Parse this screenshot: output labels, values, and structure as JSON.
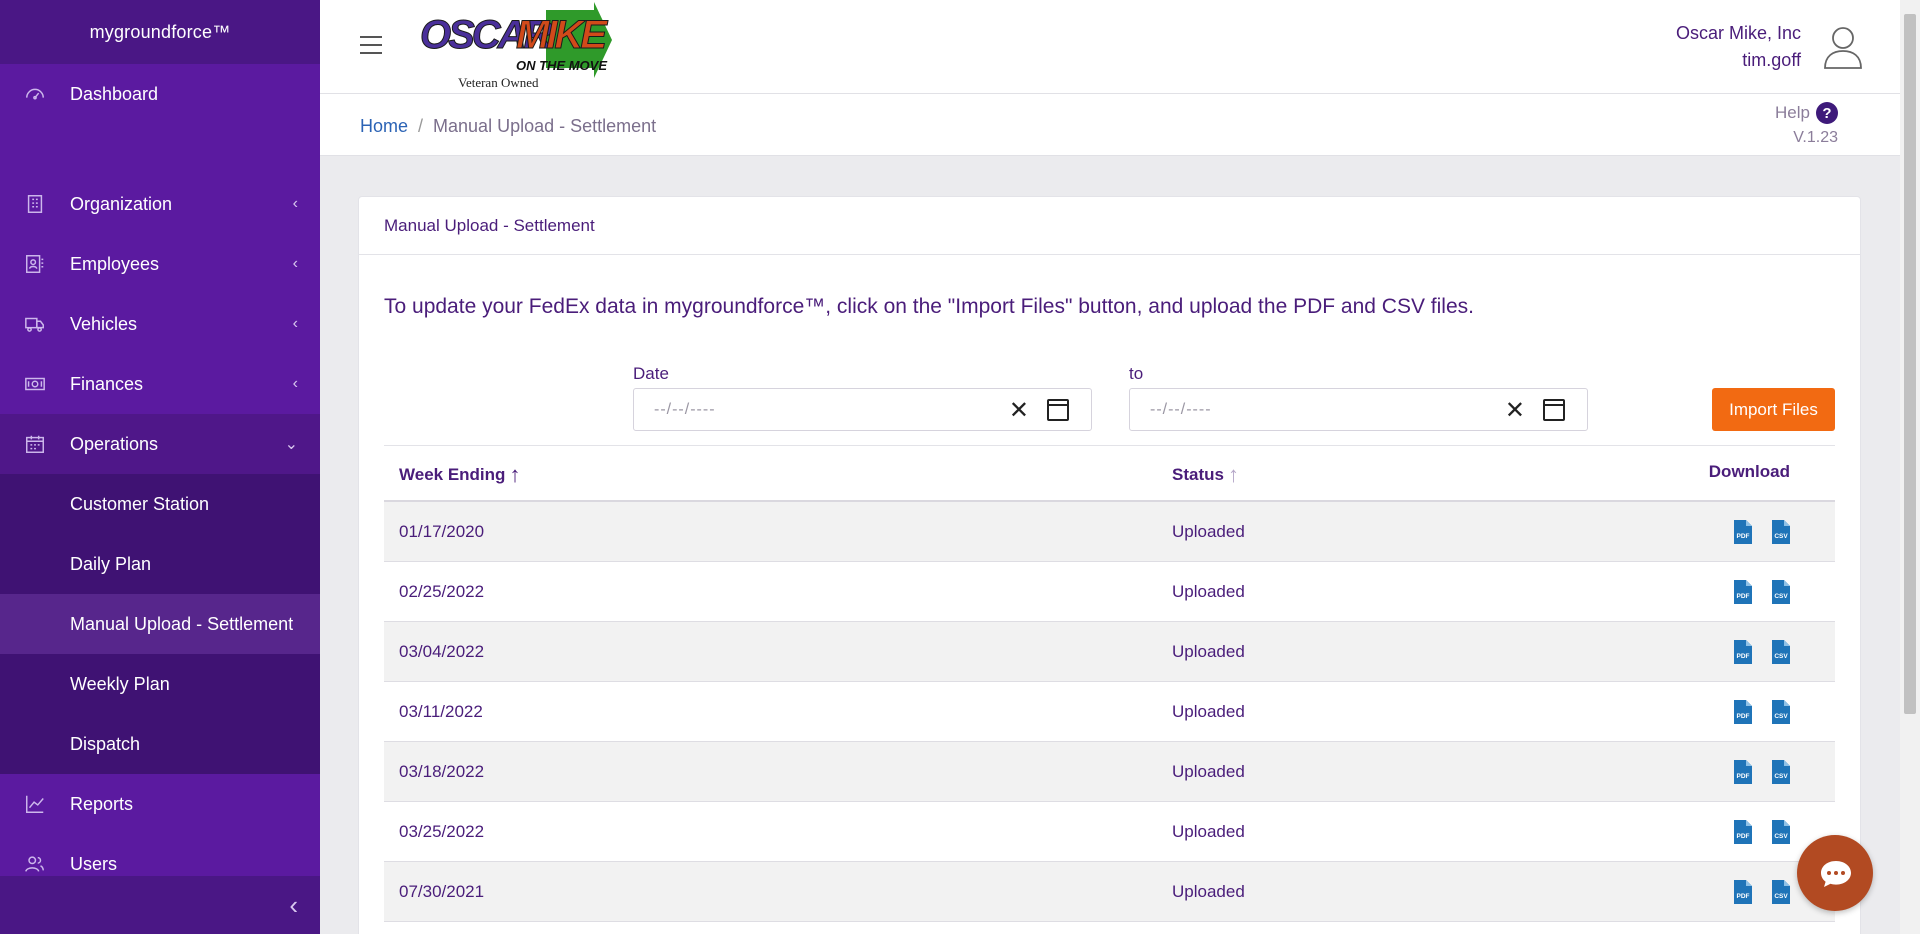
{
  "sidebar": {
    "brand": "mygroundforce™",
    "items": [
      {
        "label": "Dashboard",
        "icon": "gauge-icon"
      },
      {
        "label": "Organization",
        "icon": "building-icon",
        "chevron": "‹"
      },
      {
        "label": "Employees",
        "icon": "id-card-icon",
        "chevron": "‹"
      },
      {
        "label": "Vehicles",
        "icon": "truck-icon",
        "chevron": "‹"
      },
      {
        "label": "Finances",
        "icon": "money-icon",
        "chevron": "‹"
      },
      {
        "label": "Operations",
        "icon": "calendar-icon",
        "chevron": "⌄"
      },
      {
        "label": "Reports",
        "icon": "chart-line-icon"
      },
      {
        "label": "Users",
        "icon": "users-icon"
      }
    ],
    "operations_sub": [
      {
        "label": "Customer Station"
      },
      {
        "label": "Daily Plan"
      },
      {
        "label": "Manual Upload - Settlement",
        "active": true
      },
      {
        "label": "Weekly Plan"
      },
      {
        "label": "Dispatch"
      }
    ],
    "collapse_chevron": "‹"
  },
  "header": {
    "logo_text": "OSCARMIKE",
    "logo_sub": "ON THE MOVE",
    "logo_tagline": "Veteran Owned",
    "company": "Oscar Mike, Inc",
    "username": "tim.goff"
  },
  "breadcrumb": {
    "home": "Home",
    "separator": "/",
    "current": "Manual Upload - Settlement"
  },
  "help": {
    "label": "Help",
    "icon_glyph": "?",
    "version": "V.1.23"
  },
  "card": {
    "title": "Manual Upload - Settlement",
    "intro": "To update your FedEx data in mygroundforce™, click on the \"Import Files\" button, and upload the PDF and CSV files.",
    "date_label": "Date",
    "to_label": "to",
    "date_placeholder": "--/--/----",
    "clear_glyph": "✕",
    "import_button": "Import Files"
  },
  "table": {
    "headers": {
      "week_ending": "Week Ending",
      "status": "Status",
      "download": "Download"
    },
    "sort_arrow": "↑",
    "rows": [
      {
        "week_ending": "01/17/2020",
        "status": "Uploaded"
      },
      {
        "week_ending": "02/25/2022",
        "status": "Uploaded"
      },
      {
        "week_ending": "03/04/2022",
        "status": "Uploaded"
      },
      {
        "week_ending": "03/11/2022",
        "status": "Uploaded"
      },
      {
        "week_ending": "03/18/2022",
        "status": "Uploaded"
      },
      {
        "week_ending": "03/25/2022",
        "status": "Uploaded"
      },
      {
        "week_ending": "07/30/2021",
        "status": "Uploaded"
      }
    ],
    "file_labels": {
      "pdf": "PDF",
      "csv": "CSV"
    }
  },
  "colors": {
    "sidebar": "#5b1aa0",
    "accent_text": "#4a1d7a",
    "import_button": "#f26a12",
    "link": "#2b63b5",
    "file_icon": "#1f74b8"
  }
}
